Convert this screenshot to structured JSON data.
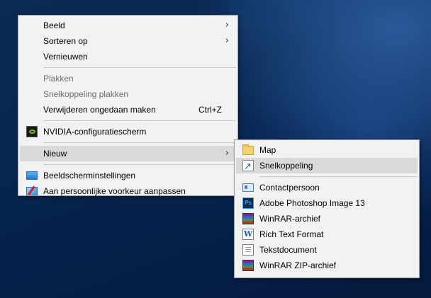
{
  "context_menu": {
    "items": [
      {
        "label": "Beeld",
        "has_submenu": true
      },
      {
        "label": "Sorteren op",
        "has_submenu": true
      },
      {
        "label": "Vernieuwen"
      },
      {
        "label": "Plakken",
        "disabled": true
      },
      {
        "label": "Snelkoppeling plakken",
        "disabled": true
      },
      {
        "label": "Verwijderen ongedaan maken",
        "shortcut": "Ctrl+Z"
      },
      {
        "label": "NVIDIA-configuratiescherm",
        "icon": "nvidia-icon"
      },
      {
        "label": "Nieuw",
        "has_submenu": true,
        "highlighted": true
      },
      {
        "label": "Beeldscherminstellingen",
        "icon": "display-settings-icon"
      },
      {
        "label": "Aan persoonlijke voorkeur aanpassen",
        "icon": "personalize-icon"
      }
    ],
    "submenu_arrow": "›"
  },
  "new_submenu": {
    "items": [
      {
        "label": "Map",
        "icon": "folder-icon"
      },
      {
        "label": "Snelkoppeling",
        "icon": "shortcut-icon",
        "highlighted": true
      },
      {
        "label": "Contactpersoon",
        "icon": "contact-icon"
      },
      {
        "label": "Adobe Photoshop Image 13",
        "icon": "photoshop-icon",
        "icon_text": "Ps"
      },
      {
        "label": "WinRAR-archief",
        "icon": "winrar-icon"
      },
      {
        "label": "Rich Text Format",
        "icon": "rtf-icon",
        "icon_text": "W"
      },
      {
        "label": "Tekstdocument",
        "icon": "text-document-icon"
      },
      {
        "label": "WinRAR ZIP-archief",
        "icon": "winrar-zip-icon"
      }
    ]
  },
  "colors": {
    "menu_bg": "#f2f2f2",
    "highlight": "#d9d9d9",
    "disabled_text": "#6d6d6d",
    "desktop_bg": "#07264f"
  }
}
